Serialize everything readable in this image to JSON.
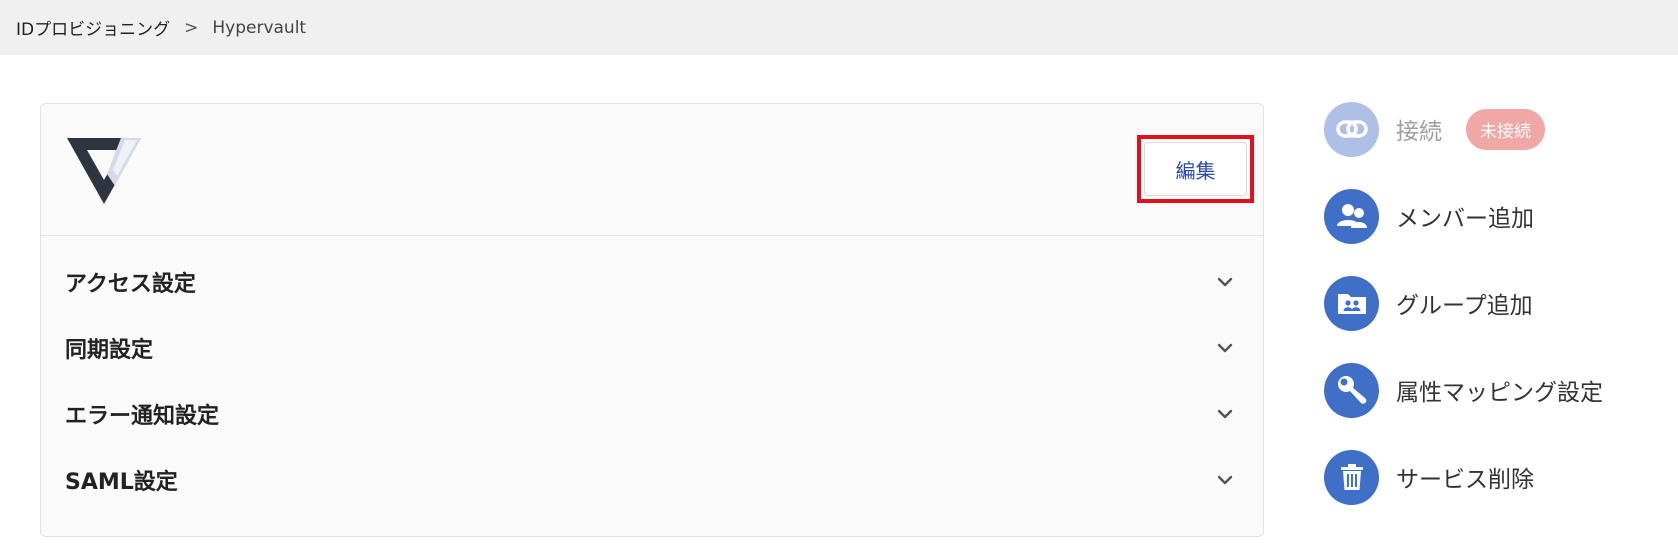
{
  "breadcrumb": {
    "root": "IDプロビジョニング",
    "separator": ">",
    "current": "Hypervault"
  },
  "service": {
    "logo_icon": "hypervault-logo",
    "edit_label": "編集"
  },
  "sections": [
    {
      "label": "アクセス設定"
    },
    {
      "label": "同期設定"
    },
    {
      "label": "エラー通知設定"
    },
    {
      "label": "SAML設定"
    }
  ],
  "sidebar": {
    "items": [
      {
        "label": "接続",
        "icon": "link-icon",
        "badge": "未接続",
        "disabled": true
      },
      {
        "label": "メンバー追加",
        "icon": "users-icon"
      },
      {
        "label": "グループ追加",
        "icon": "group-folder-icon"
      },
      {
        "label": "属性マッピング設定",
        "icon": "wrench-icon"
      },
      {
        "label": "サービス削除",
        "icon": "trash-icon"
      }
    ]
  },
  "colors": {
    "accent": "#3f6fc6",
    "accent_disabled": "#aec0e6",
    "badge": "#f0a7a5",
    "highlight": "#e0101c",
    "edit_text": "#2b4aa8"
  }
}
